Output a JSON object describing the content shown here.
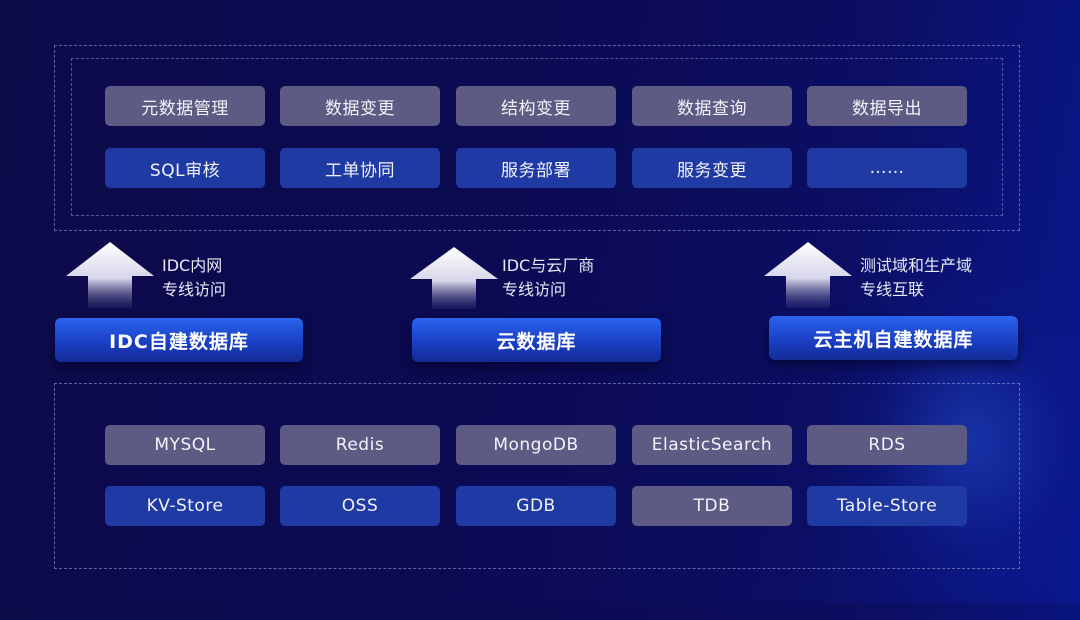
{
  "top_tiles": [
    [
      "元数据管理",
      "数据变更",
      "结构变更",
      "数据查询",
      "数据导出"
    ],
    [
      "SQL审核",
      "工单协同",
      "服务部署",
      "服务变更",
      "……"
    ]
  ],
  "access": [
    {
      "label_line1": "IDC内网",
      "label_line2": "专线访问",
      "db": "IDC自建数据库"
    },
    {
      "label_line1": "IDC与云厂商",
      "label_line2": "专线访问",
      "db": "云数据库"
    },
    {
      "label_line1": "测试域和生产域",
      "label_line2": "专线互联",
      "db": "云主机自建数据库"
    }
  ],
  "bottom_tiles": [
    [
      "MYSQL",
      "Redis",
      "MongoDB",
      "ElasticSearch",
      "RDS"
    ],
    [
      "KV-Store",
      "OSS",
      "GDB",
      "TDB",
      "Table-Store"
    ]
  ],
  "colors": {
    "tile_gray": "#5d5b83",
    "tile_blue": "#1f3aa3",
    "db_bar": "#1a3fc4",
    "background": "#0d0b4a"
  }
}
